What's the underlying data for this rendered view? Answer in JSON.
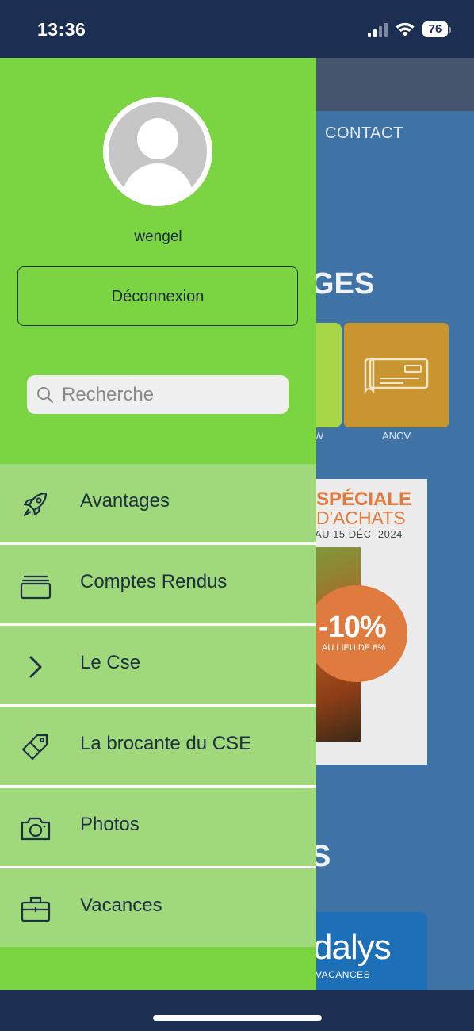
{
  "status_bar": {
    "time": "13:36",
    "battery": "76"
  },
  "background": {
    "nav_contact": "CONTACT",
    "heading_fragment": "GES",
    "tile_labels": [
      "W",
      "ANCV"
    ],
    "promo": {
      "line1": "SPÉCIALE",
      "line2": "D'ACHATS",
      "date": "AU 15 DÉC. 2024",
      "discount": "-10%",
      "discount_note": "AU LIEU DE 8%"
    },
    "section_fragment": "S",
    "odalys": {
      "brand": "dalys",
      "sub": "VACANCES"
    }
  },
  "drawer": {
    "username": "wengel",
    "logout_label": "Déconnexion",
    "search_placeholder": "Recherche",
    "menu": [
      {
        "label": "Avantages",
        "icon": "rocket-icon"
      },
      {
        "label": "Comptes Rendus",
        "icon": "stack-icon"
      },
      {
        "label": "Le Cse",
        "icon": "chevron-right-icon"
      },
      {
        "label": "La brocante du CSE",
        "icon": "tag-icon"
      },
      {
        "label": "Photos",
        "icon": "camera-icon"
      },
      {
        "label": "Vacances",
        "icon": "briefcase-icon"
      }
    ]
  },
  "colors": {
    "drawer_green": "#7bd442",
    "menu_green": "#9fd97c",
    "status_navy": "#1c2f52",
    "app_blue": "#3f72a5"
  }
}
